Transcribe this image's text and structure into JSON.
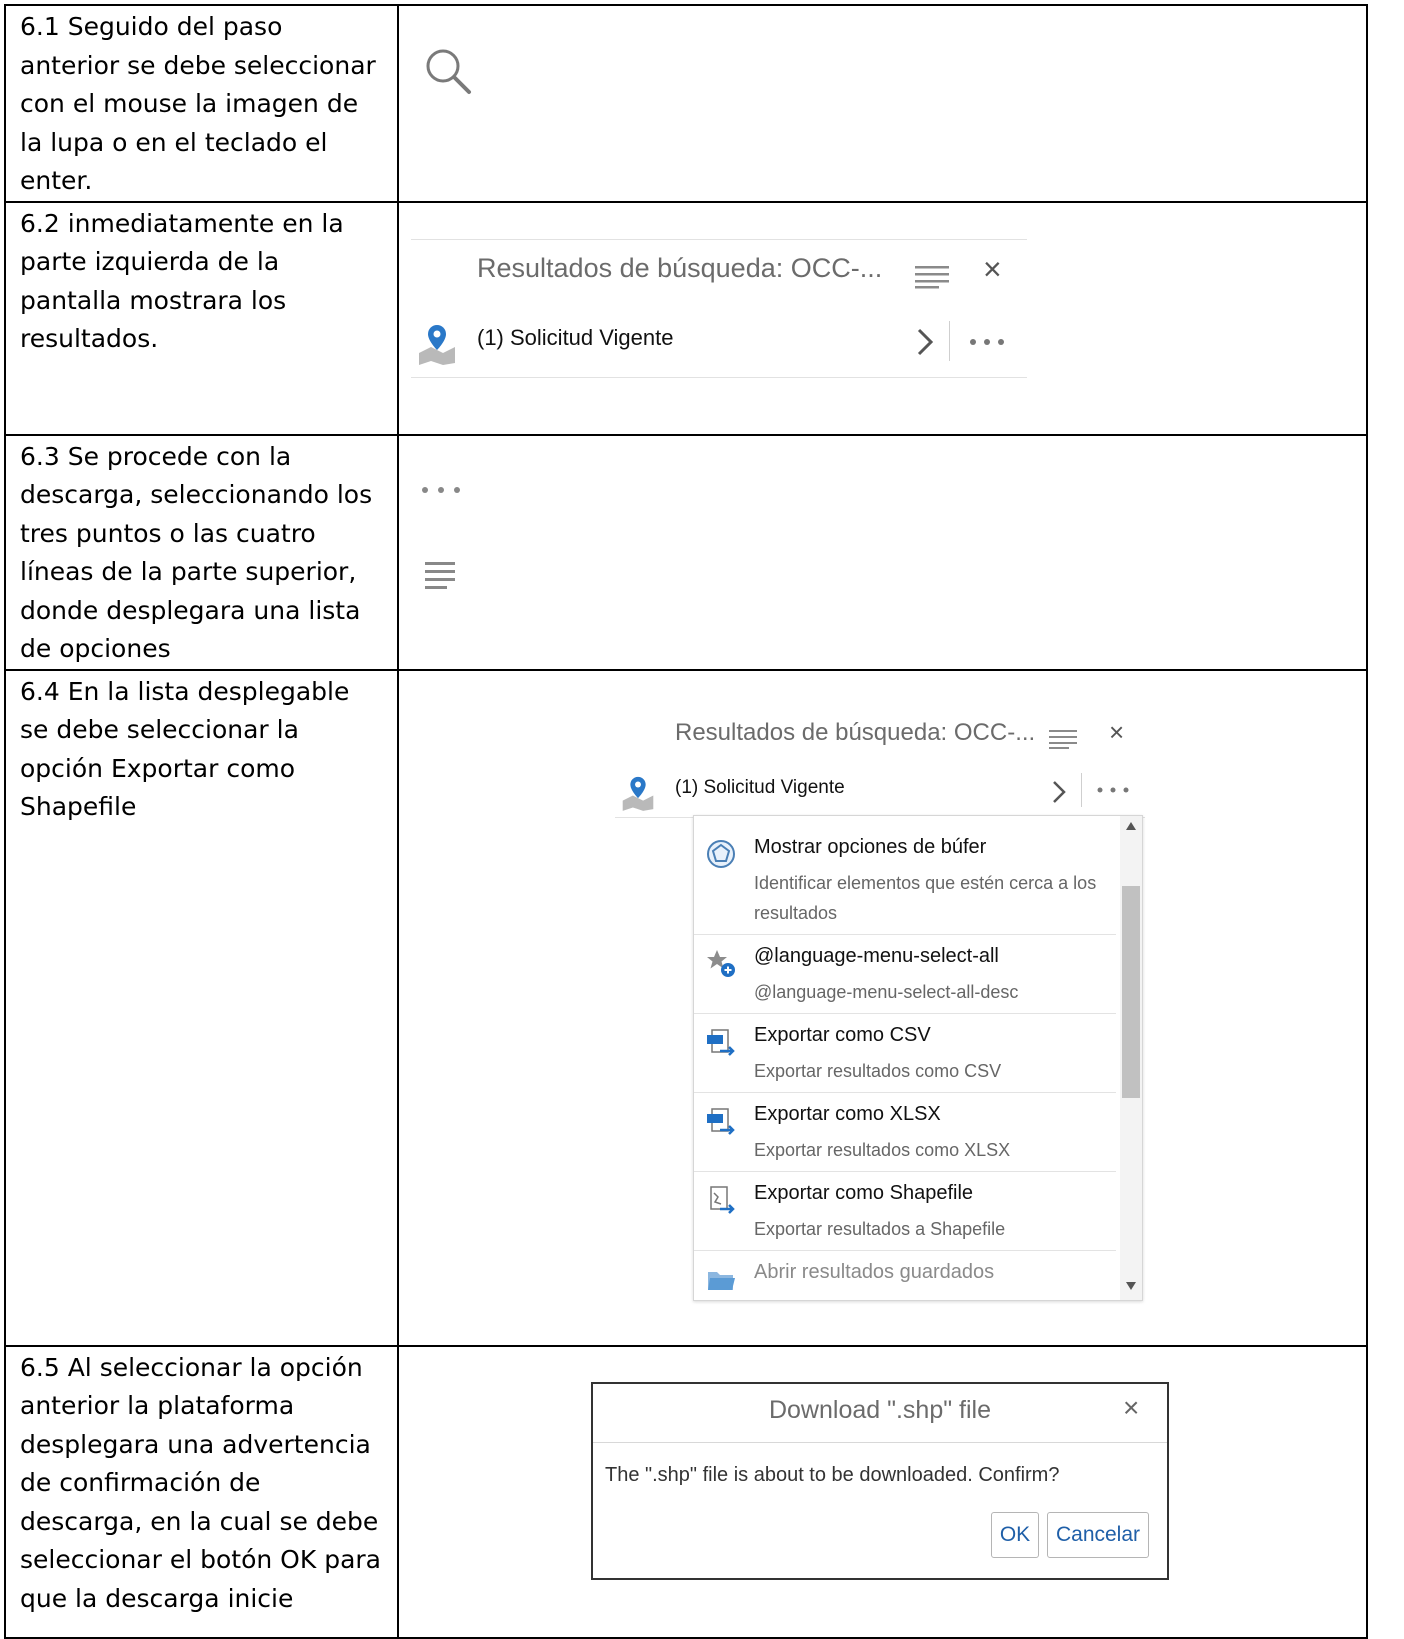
{
  "steps": [
    {
      "text": "6.1 Seguido del paso anterior se debe seleccionar con el mouse la imagen de la lupa o en el teclado el enter."
    },
    {
      "text": "6.2 inmediatamente en la parte izquierda de la pantalla mostrara los resultados."
    },
    {
      "text": "6.3 Se procede con la descarga, seleccionando los tres puntos o las cuatro líneas de la parte superior, donde desplegara una lista de opciones"
    },
    {
      "text": "6.4 En la lista desplegable se debe seleccionar la opción Exportar como Shapefile"
    },
    {
      "text": "6.5 Al seleccionar la opción anterior la plataforma desplegara una advertencia de confirmación de descarga, en la cual se debe seleccionar el botón OK para que la descarga inicie"
    }
  ],
  "results_panel": {
    "title": "Resultados de búsqueda: OCC-...",
    "close": "×",
    "result_label": "(1) Solicitud Vigente",
    "chevron": "›",
    "more": "•••"
  },
  "menu": {
    "items": [
      {
        "title": "Mostrar opciones de búfer",
        "desc": "Identificar elementos que estén cerca a los resultados",
        "icon": "buffer-icon"
      },
      {
        "title": "@language-menu-select-all",
        "desc": "@language-menu-select-all-desc",
        "icon": "select-all-star-icon"
      },
      {
        "title": "Exportar como CSV",
        "desc": "Exportar resultados como CSV",
        "icon": "csv-export-icon"
      },
      {
        "title": "Exportar como XLSX",
        "desc": "Exportar resultados como XLSX",
        "icon": "xlsx-export-icon"
      },
      {
        "title": "Exportar como Shapefile",
        "desc": "Exportar resultados a Shapefile",
        "icon": "shapefile-export-icon"
      },
      {
        "title": "Abrir resultados guardados",
        "desc": "",
        "icon": "folder-icon"
      }
    ]
  },
  "dialog": {
    "title": "Download \".shp\" file",
    "close": "×",
    "message": "The \".shp\" file is about to be downloaded. Confirm?",
    "ok_label": "OK",
    "cancel_label": "Cancelar"
  },
  "colors": {
    "accent_blue": "#1f6fc4",
    "text_gray": "#6b6b6b",
    "border_dark": "#333333"
  }
}
